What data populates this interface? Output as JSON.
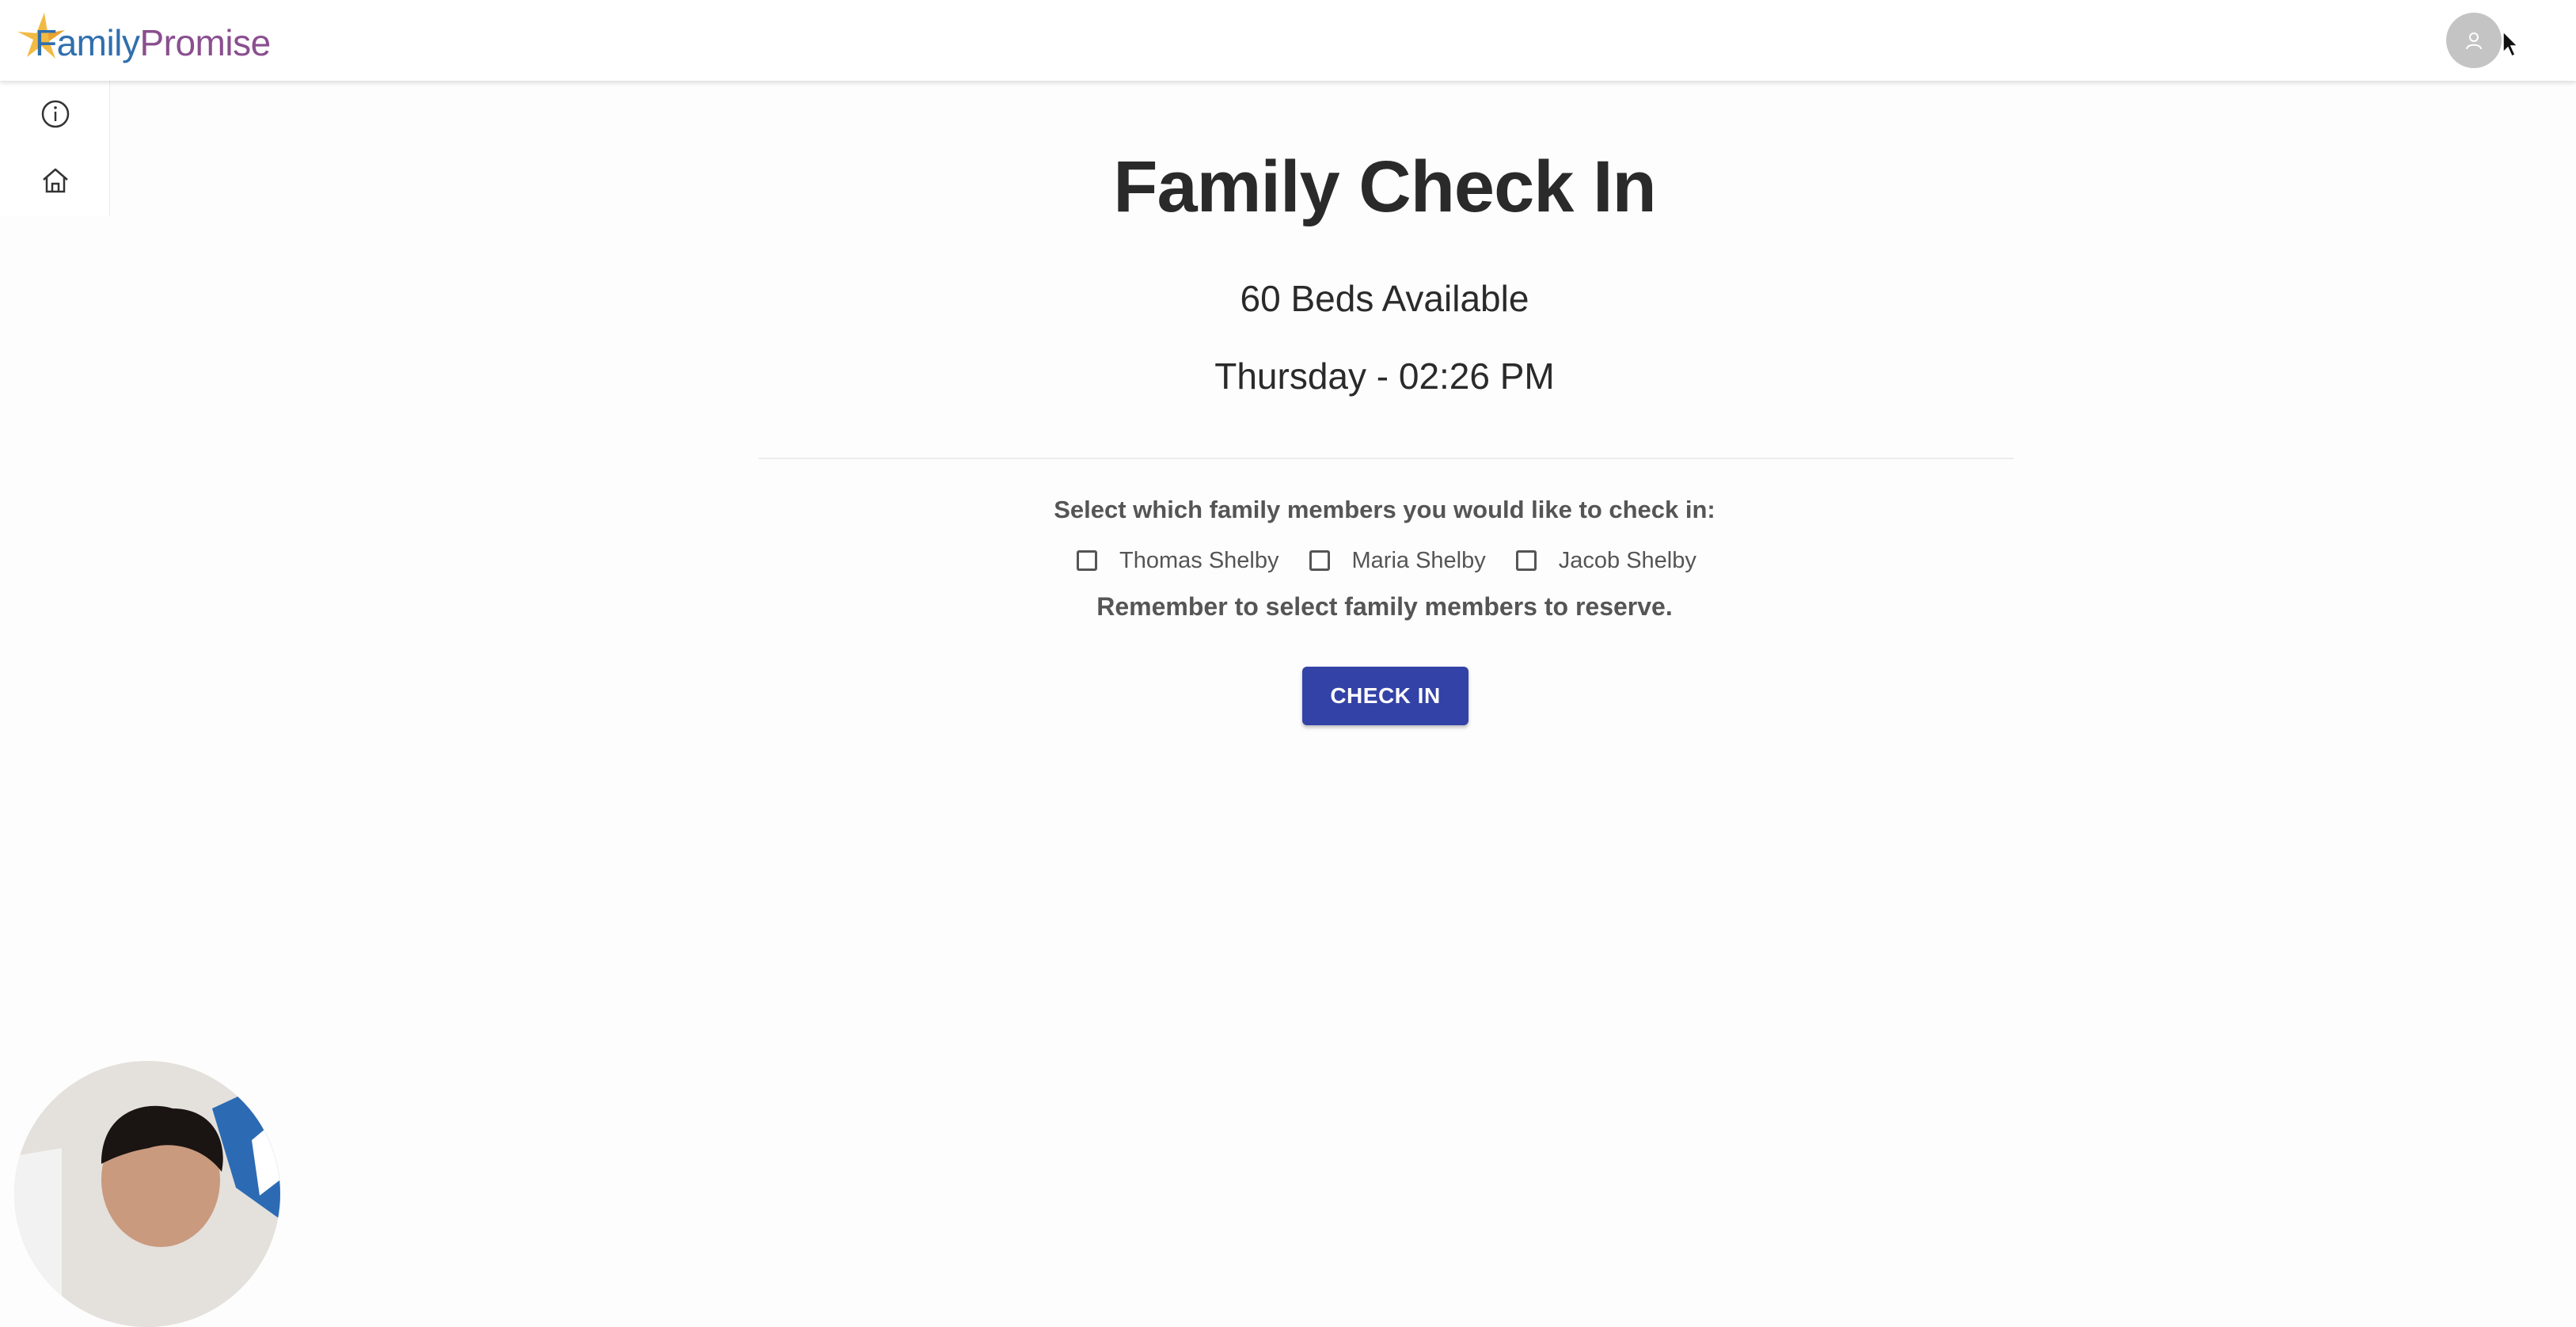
{
  "header": {
    "logo": {
      "family": "Family",
      "promise": "Promise"
    },
    "avatar_icon": "user-icon"
  },
  "sidebar": {
    "items": [
      {
        "icon": "info-icon"
      },
      {
        "icon": "home-icon"
      }
    ]
  },
  "main": {
    "title": "Family Check In",
    "beds_available": "60 Beds Available",
    "datetime": "Thursday - 02:26 PM",
    "select_label": "Select which family members you would like to check in:",
    "members": [
      {
        "name": "Thomas Shelby",
        "checked": false
      },
      {
        "name": "Maria Shelby",
        "checked": false
      },
      {
        "name": "Jacob Shelby",
        "checked": false
      }
    ],
    "reminder": "Remember to select family members to reserve.",
    "checkin_label": "CHECK IN"
  },
  "colors": {
    "primary_button": "#3342a6",
    "logo_family": "#2f6fae",
    "logo_promise": "#8a4f8f",
    "logo_star": "#f0b22f"
  }
}
